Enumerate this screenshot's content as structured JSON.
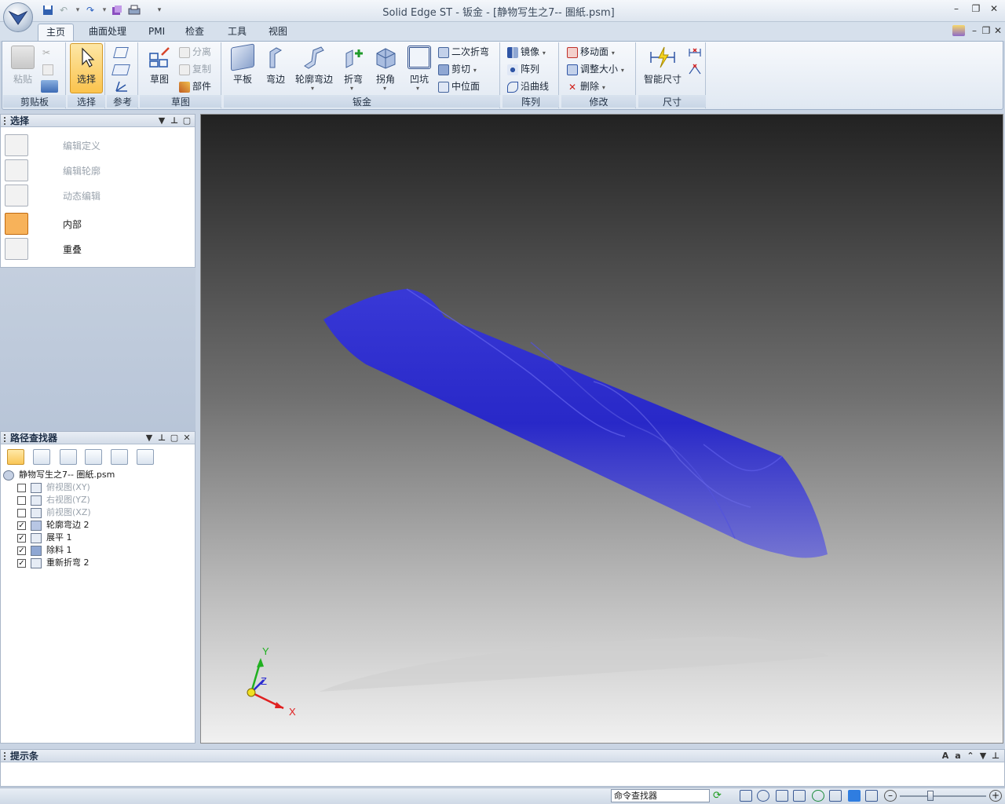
{
  "window": {
    "title": "Solid Edge ST - 钣金 - [静物写生之7-- 圏紙.psm]"
  },
  "tabs": [
    {
      "label": "主页",
      "active": true
    },
    {
      "label": "曲面处理"
    },
    {
      "label": "PMI"
    },
    {
      "label": "检查"
    },
    {
      "label": "工具"
    },
    {
      "label": "视图"
    }
  ],
  "ribbon": {
    "clipboard": {
      "label": "剪贴板",
      "paste": "粘贴"
    },
    "select": {
      "label": "选择",
      "select_btn": "选择"
    },
    "reference": {
      "label": "参考"
    },
    "sketch": {
      "label": "草图",
      "sketch_btn": "草图",
      "separate": "分离",
      "copy": "复制",
      "part": "部件"
    },
    "sheetmetal": {
      "label": "钣金",
      "tab": "平板",
      "flange": "弯边",
      "contour_flange": "轮廓弯边",
      "fold": "折弯",
      "corner": "拐角",
      "dimple": "凹坑",
      "secondary_fold": "二次折弯",
      "cut": "剪切",
      "midplane": "中位面"
    },
    "pattern": {
      "label": "阵列",
      "mirror": "镜像",
      "array": "阵列",
      "along_curve": "沿曲线"
    },
    "modify": {
      "label": "修改",
      "move_face": "移动面",
      "resize": "调整大小",
      "delete": "删除"
    },
    "dimension": {
      "label": "尺寸",
      "smart_dim": "智能尺寸"
    }
  },
  "select_panel": {
    "title": "选择",
    "items": [
      {
        "label": "编辑定义",
        "enabled": false
      },
      {
        "label": "编辑轮廓",
        "enabled": false
      },
      {
        "label": "动态编辑",
        "enabled": false
      },
      {
        "label": "内部",
        "enabled": true
      },
      {
        "label": "重叠",
        "enabled": true
      }
    ]
  },
  "path_finder": {
    "title": "路径查找器",
    "root": "静物写生之7-- 圏紙.psm",
    "items": [
      {
        "label": "俯视图(XY)",
        "checked": false,
        "enabled": false
      },
      {
        "label": "右视图(YZ)",
        "checked": false,
        "enabled": false
      },
      {
        "label": "前视图(XZ)",
        "checked": false,
        "enabled": false
      },
      {
        "label": "轮廓弯边 2",
        "checked": true,
        "enabled": true
      },
      {
        "label": "展平 1",
        "checked": true,
        "enabled": true
      },
      {
        "label": "除料 1",
        "checked": true,
        "enabled": true
      },
      {
        "label": "重新折弯 2",
        "checked": true,
        "enabled": true
      }
    ]
  },
  "viewport": {
    "axis_x": "X",
    "axis_y": "Y",
    "axis_z": "Z",
    "model_color": "#2a2ae8"
  },
  "prompt_bar": {
    "title": "提示条"
  },
  "status_bar": {
    "command_finder": "命令查找器"
  }
}
